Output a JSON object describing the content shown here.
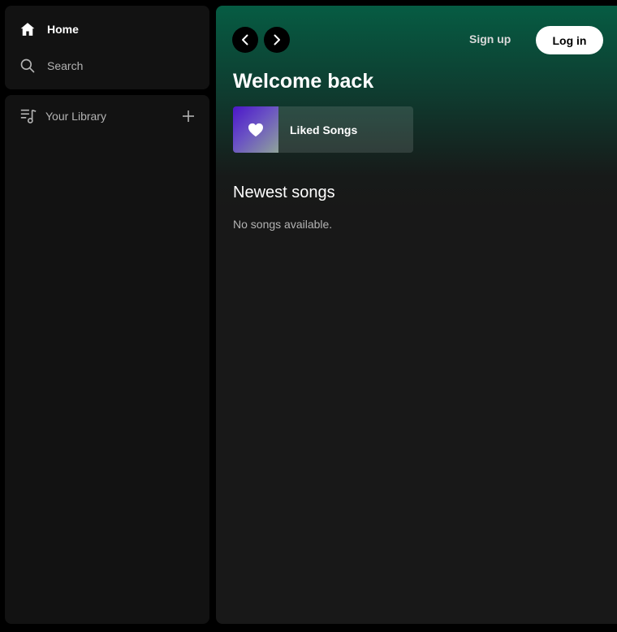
{
  "sidebar": {
    "items": [
      {
        "label": "Home",
        "icon": "home-icon",
        "active": true
      },
      {
        "label": "Search",
        "icon": "search-icon",
        "active": false
      }
    ],
    "library": {
      "label": "Your Library",
      "icon": "library-icon",
      "add_icon": "plus-icon"
    }
  },
  "header": {
    "back_icon": "chevron-left-icon",
    "forward_icon": "chevron-right-icon",
    "signup_label": "Sign up",
    "login_label": "Log in"
  },
  "main": {
    "greeting": "Welcome back",
    "shortcuts": [
      {
        "title": "Liked Songs",
        "icon": "heart-icon"
      }
    ],
    "newest": {
      "title": "Newest songs",
      "empty_message": "No songs available."
    }
  },
  "colors": {
    "accent_gradient_top": "#065c43",
    "panel_background": "#121212",
    "main_background": "#181818",
    "muted_text": "#b3b3b3",
    "liked_cover_start": "#4b16c9",
    "liked_cover_end": "#8fa39a"
  }
}
